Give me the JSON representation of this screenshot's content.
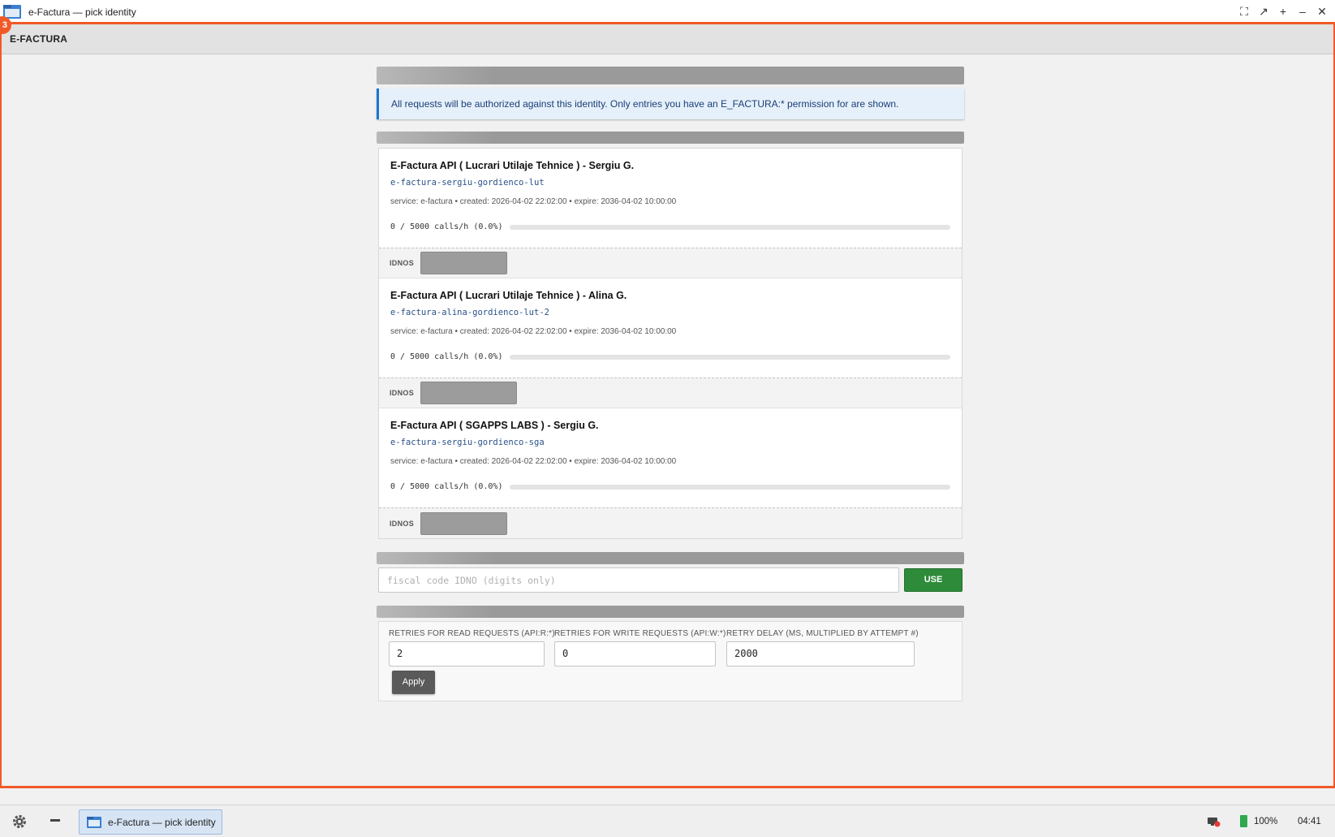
{
  "window": {
    "title": "e-Factura — pick identity",
    "badge": "3"
  },
  "app": {
    "header_title": "E-FACTURA"
  },
  "info_message": "All requests will be authorized against this identity. Only entries you have an E_FACTURA:* permission for are shown.",
  "identities": [
    {
      "name": "E-Factura API ( Lucrari Utilaje Tehnice ) - Sergiu G.",
      "slug": "e-factura-sergiu-gordienco-lut",
      "meta": "service: e-factura • created: 2026-04-02 22:02:00 • expire: 2036-04-02 10:00:00",
      "usage_text": "0 / 5000 calls/h (0.0%)",
      "usage_fraction": 0,
      "idnos_label": "IDNOS"
    },
    {
      "name": "E-Factura API ( Lucrari Utilaje Tehnice ) - Alina G.",
      "slug": "e-factura-alina-gordienco-lut-2",
      "meta": "service: e-factura • created: 2026-04-02 22:02:00 • expire: 2036-04-02 10:00:00",
      "usage_text": "0 / 5000 calls/h (0.0%)",
      "usage_fraction": 0,
      "idnos_label": "IDNOS"
    },
    {
      "name": "E-Factura API ( SGAPPS LABS ) - Sergiu G.",
      "slug": "e-factura-sergiu-gordienco-sga",
      "meta": "service: e-factura • created: 2026-04-02 22:02:00 • expire: 2036-04-02 10:00:00",
      "usage_text": "0 / 5000 calls/h (0.0%)",
      "usage_fraction": 0,
      "idnos_label": "IDNOS"
    }
  ],
  "idno_form": {
    "placeholder": "fiscal code IDNO (digits only)",
    "value": "",
    "use_label": "USE"
  },
  "retry": {
    "read_label": "RETRIES FOR READ REQUESTS (API:R:*)",
    "read_value": "2",
    "write_label": "RETRIES FOR WRITE REQUESTS (API:W:*)",
    "write_value": "0",
    "delay_label": "RETRY DELAY (MS, MULTIPLIED BY ATTEMPT #)",
    "delay_value": "2000",
    "apply_label": "Apply"
  },
  "taskbar": {
    "task_label": "e-Factura — pick identity",
    "battery": "100%",
    "clock": "04:41"
  },
  "colors": {
    "accent": "#f05a28",
    "use_button": "#2e8b3a",
    "info_border": "#1976d2",
    "slug_text": "#2a5187"
  },
  "icons": [
    "folder-icon",
    "fullscreen-icon",
    "detach-icon",
    "new-window-icon",
    "minimize-icon",
    "close-icon",
    "gear-icon",
    "network-icon",
    "battery-icon"
  ]
}
